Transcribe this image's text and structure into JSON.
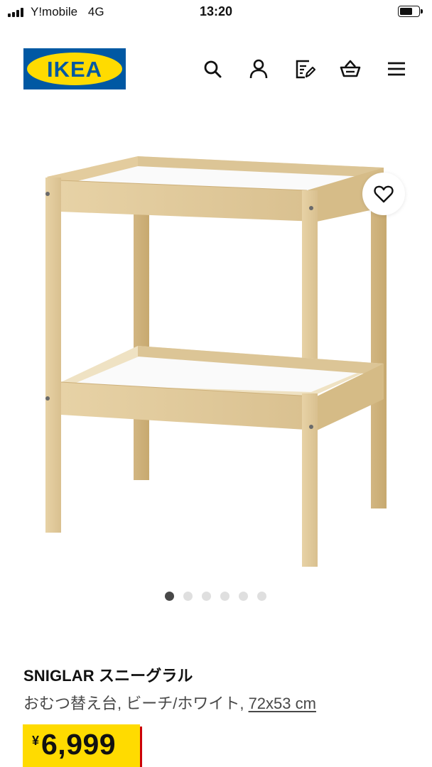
{
  "status_bar": {
    "carrier": "Y!mobile",
    "network": "4G",
    "time": "13:20"
  },
  "header": {
    "brand": "IKEA",
    "icons": [
      "search-icon",
      "account-icon",
      "shopping-list-icon",
      "cart-icon",
      "menu-icon"
    ]
  },
  "gallery": {
    "total_images": 6,
    "active_index": 0
  },
  "product": {
    "name": "SNIGLAR スニーグラル",
    "description_prefix": "おむつ替え台, ビーチ/ホワイト, ",
    "dimensions": "72x53 cm",
    "currency_symbol": "¥",
    "price": "6,999"
  },
  "colors": {
    "ikea_blue": "#0058a3",
    "ikea_yellow": "#ffdb00",
    "price_shadow_red": "#cc0008"
  }
}
